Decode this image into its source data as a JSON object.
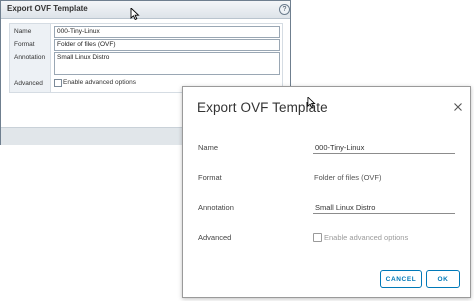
{
  "old_dialog": {
    "title": "Export OVF Template",
    "help_label": "?",
    "labels": {
      "name": "Name",
      "format": "Format",
      "annotation": "Annotation",
      "advanced": "Advanced"
    },
    "values": {
      "name": "000-Tiny-Linux",
      "format": "Folder of files (OVF)",
      "annotation": "Small Linux Distro"
    },
    "advanced_option_label": "Enable advanced options",
    "advanced_checked": false
  },
  "new_dialog": {
    "title": "Export OVF Template",
    "labels": {
      "name": "Name",
      "format": "Format",
      "annotation": "Annotation",
      "advanced": "Advanced"
    },
    "values": {
      "name": "000-Tiny-Linux",
      "format": "Folder of files (OVF)",
      "annotation": "Small Linux Distro"
    },
    "advanced_option_label": "Enable advanced options",
    "advanced_checked": false,
    "buttons": {
      "cancel": "CANCEL",
      "ok": "OK"
    }
  },
  "colors": {
    "accent": "#0079b8",
    "old_label_bg": "#edf1f5",
    "old_footer_bg": "#e1e6ea"
  },
  "icons": {
    "help": "help-icon",
    "close": "close-icon",
    "cursor": "mouse-cursor-icon"
  }
}
